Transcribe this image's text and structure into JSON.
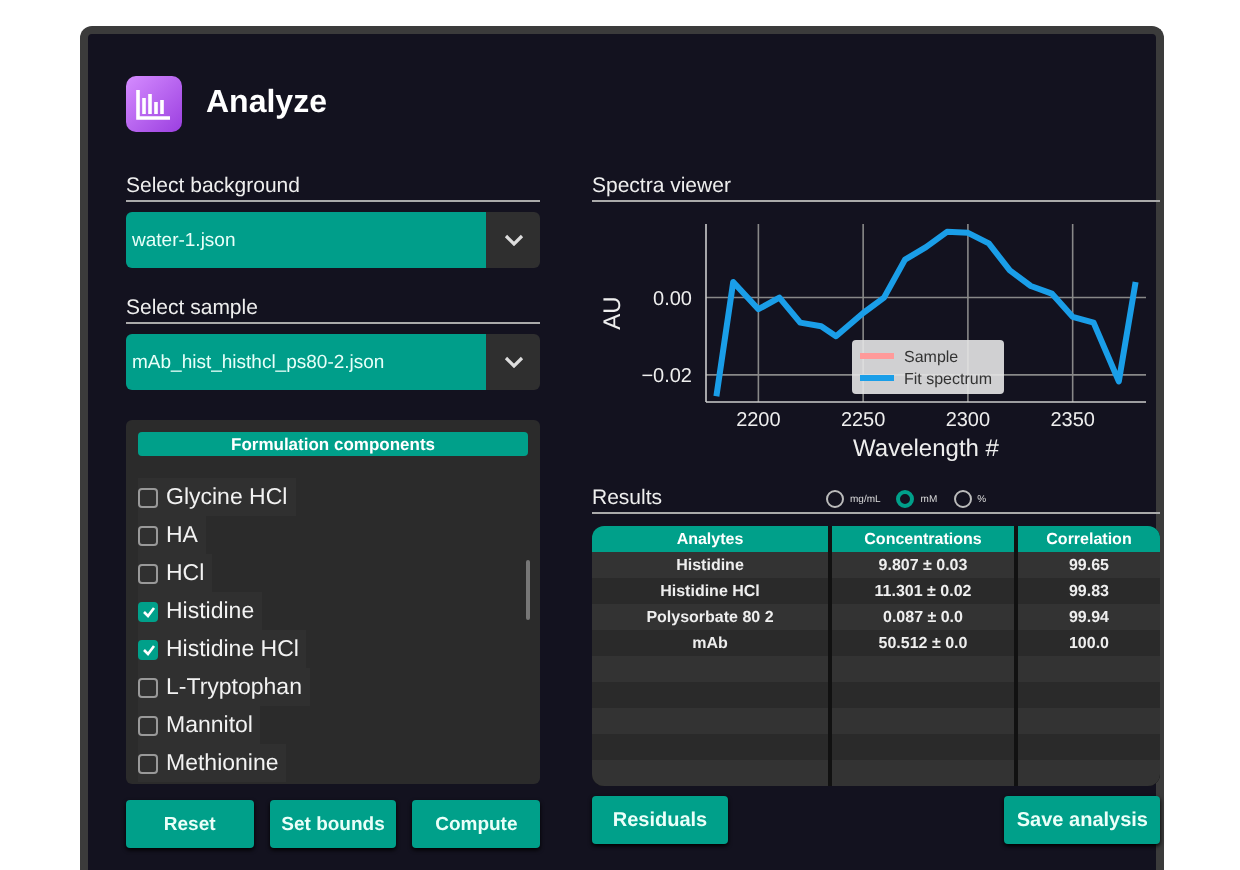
{
  "app": {
    "title": "Analyze"
  },
  "background_select": {
    "label": "Select background",
    "value": "water-1.json"
  },
  "sample_select": {
    "label": "Select sample",
    "value": "mAb_hist_histhcl_ps80-2.json"
  },
  "components": {
    "title": "Formulation components",
    "items": [
      {
        "label": "Glycine HCl",
        "checked": false
      },
      {
        "label": "HA",
        "checked": false
      },
      {
        "label": "HCl",
        "checked": false
      },
      {
        "label": "Histidine",
        "checked": true
      },
      {
        "label": "Histidine HCl",
        "checked": true
      },
      {
        "label": "L-Tryptophan",
        "checked": false
      },
      {
        "label": "Mannitol",
        "checked": false
      },
      {
        "label": "Methionine",
        "checked": false
      }
    ]
  },
  "left_buttons": [
    "Reset",
    "Set bounds",
    "Compute"
  ],
  "spectra_viewer": {
    "title": "Spectra viewer",
    "chart_data": {
      "type": "line",
      "xlabel": "Wavelength #",
      "ylabel": "AU",
      "x": [
        2180,
        2188,
        2200,
        2210,
        2220,
        2230,
        2237,
        2250,
        2260,
        2270,
        2280,
        2290,
        2300,
        2310,
        2320,
        2330,
        2340,
        2350,
        2360,
        2372,
        2380
      ],
      "series": [
        {
          "name": "Sample",
          "color": "#ff9a9a",
          "values": [
            null,
            null,
            null,
            null,
            null,
            null,
            null,
            null,
            null,
            null,
            null,
            null,
            null,
            null,
            null,
            null,
            null,
            null,
            null,
            null,
            null
          ]
        },
        {
          "name": "Fit spectrum",
          "color": "#1a9ee8",
          "values": [
            -0.0255,
            0.004,
            -0.003,
            0.0,
            -0.0065,
            -0.0074,
            -0.01,
            -0.004,
            0.0,
            0.0098,
            0.013,
            0.017,
            0.0167,
            0.014,
            0.007,
            0.003,
            0.001,
            -0.005,
            -0.0065,
            -0.0217,
            0.004
          ]
        }
      ],
      "xlim": [
        2175,
        2385
      ],
      "ylim": [
        -0.027,
        0.019
      ],
      "grid": true,
      "legend": true,
      "xticks": [
        2200,
        2250,
        2300,
        2350
      ],
      "yticks": [
        {
          "value": 0,
          "label": "0.00"
        },
        {
          "value": -0.02,
          "label": "−0.02"
        }
      ]
    }
  },
  "results": {
    "title": "Results",
    "units": [
      {
        "label": "mg/mL",
        "selected": false
      },
      {
        "label": "mM",
        "selected": true
      },
      {
        "label": "%",
        "selected": false
      }
    ],
    "table": {
      "columns": [
        "Analytes",
        "Concentrations",
        "Correlation"
      ],
      "rows": [
        [
          "Histidine",
          "9.807 ± 0.03",
          "99.65"
        ],
        [
          "Histidine HCl",
          "11.301 ± 0.02",
          "99.83"
        ],
        [
          "Polysorbate 80 2",
          "0.087 ± 0.0",
          "99.94"
        ],
        [
          "mAb",
          "50.512 ± 0.0",
          "100.0"
        ]
      ]
    }
  },
  "right_buttons": [
    "Residuals",
    "Save analysis"
  ]
}
